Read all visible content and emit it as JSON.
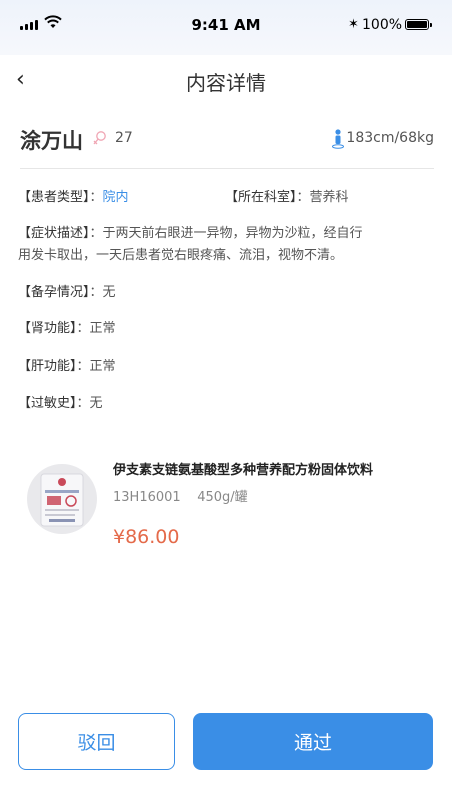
{
  "status_bar": {
    "time": "9:41 AM",
    "battery": "100%"
  },
  "nav": {
    "title": "内容详情"
  },
  "patient": {
    "name": "涂万山",
    "age": "27",
    "metrics": "183cm/68kg"
  },
  "info": {
    "patient_type_label": "【患者类型】",
    "patient_type_value": "院内",
    "department_label": "【所在科室】",
    "department_value": "营养科",
    "symptom_label": "【症状描述】",
    "symptom_line1": "于两天前右眼进一异物，异物为沙粒，经自行",
    "symptom_line2": "用发卡取出，一天后患者觉右眼疼痛、流泪，视物不清。",
    "pregnancy_label": "【备孕情况】",
    "pregnancy_value": "无",
    "kidney_label": "【肾功能】",
    "kidney_value": "正常",
    "liver_label": "【肝功能】",
    "liver_value": "正常",
    "allergy_label": "【过敏史】",
    "allergy_value": "无",
    "sep": "："
  },
  "product": {
    "name": "伊支素支链氨基酸型多种营养配方粉固体饮料",
    "code": "13H16001",
    "spec": "450g/罐",
    "price": "¥86.00"
  },
  "actions": {
    "reject": "驳回",
    "pass": "通过"
  },
  "colors": {
    "accent": "#3a8ee6",
    "price": "#e46a4a"
  }
}
